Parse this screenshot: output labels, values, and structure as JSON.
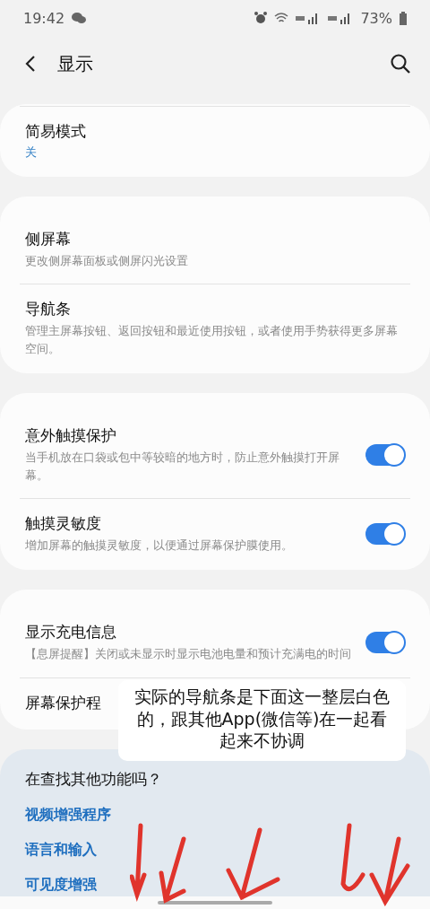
{
  "status_bar": {
    "time": "19:42",
    "battery": "73%"
  },
  "header": {
    "title": "显示"
  },
  "cards": [
    {
      "items": [
        {
          "title": "简易模式",
          "value": "关"
        }
      ]
    },
    {
      "items": [
        {
          "title": "侧屏幕",
          "subtitle": "更改侧屏幕面板或侧屏闪光设置"
        },
        {
          "title": "导航条",
          "subtitle": "管理主屏幕按钮、返回按钮和最近使用按钮，或者使用手势获得更多屏幕空间。"
        }
      ]
    },
    {
      "items": [
        {
          "title": "意外触摸保护",
          "subtitle": "当手机放在口袋或包中等较暗的地方时，防止意外触摸打开屏幕。",
          "on": true
        },
        {
          "title": "触摸灵敏度",
          "subtitle": "增加屏幕的触摸灵敏度，以便通过屏幕保护膜使用。",
          "on": true
        }
      ]
    },
    {
      "items": [
        {
          "title": "显示充电信息",
          "subtitle": "【息屏提醒】关闭或未显示时显示电池电量和预计充满电的时间",
          "on": true
        },
        {
          "title": "屏幕保护程"
        }
      ]
    }
  ],
  "suggestions": {
    "title": "在查找其他功能吗？",
    "links": [
      "视频增强程序",
      "语言和输入",
      "可见度增强"
    ]
  },
  "annotation": "实际的导航条是下面这一整层白色的，跟其他App(微信等)在一起看起来不协调"
}
